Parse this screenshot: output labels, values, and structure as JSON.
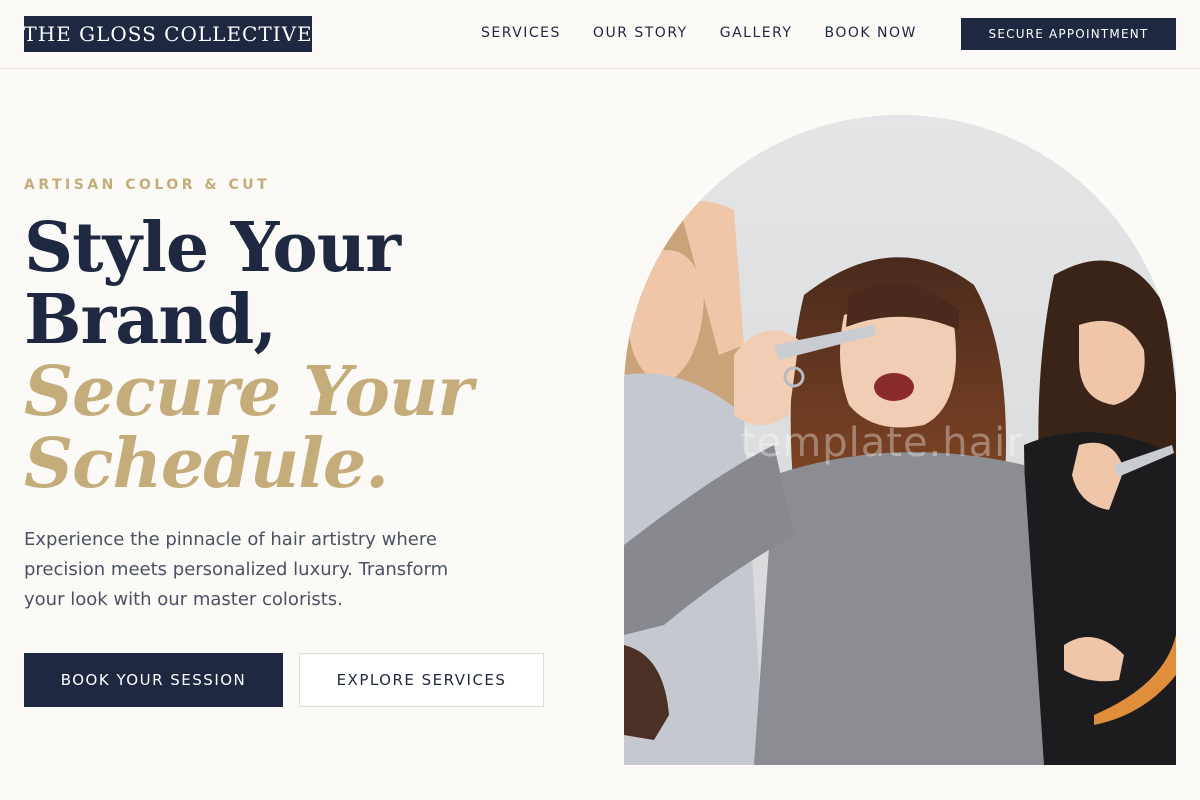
{
  "header": {
    "logo": "THE GLOSS COLLECTIVE",
    "nav": [
      {
        "label": "SERVICES"
      },
      {
        "label": "OUR STORY"
      },
      {
        "label": "GALLERY"
      },
      {
        "label": "BOOK NOW"
      }
    ],
    "cta": "SECURE APPOINTMENT"
  },
  "hero": {
    "eyebrow": "ARTISAN COLOR & CUT",
    "headline_line1": "Style Your",
    "headline_line2": "Brand,",
    "headline_line3": "Secure Your",
    "headline_line4": "Schedule.",
    "description": "Experience the pinnacle of hair artistry where precision meets personalized luxury. Transform your look with our master colorists.",
    "primary_button": "BOOK YOUR SESSION",
    "secondary_button": "EXPLORE SERVICES",
    "image_watermark": "template.hair"
  },
  "colors": {
    "navy": "#1e2840",
    "gold": "#c4ad7b",
    "background": "#fbfaf7"
  }
}
